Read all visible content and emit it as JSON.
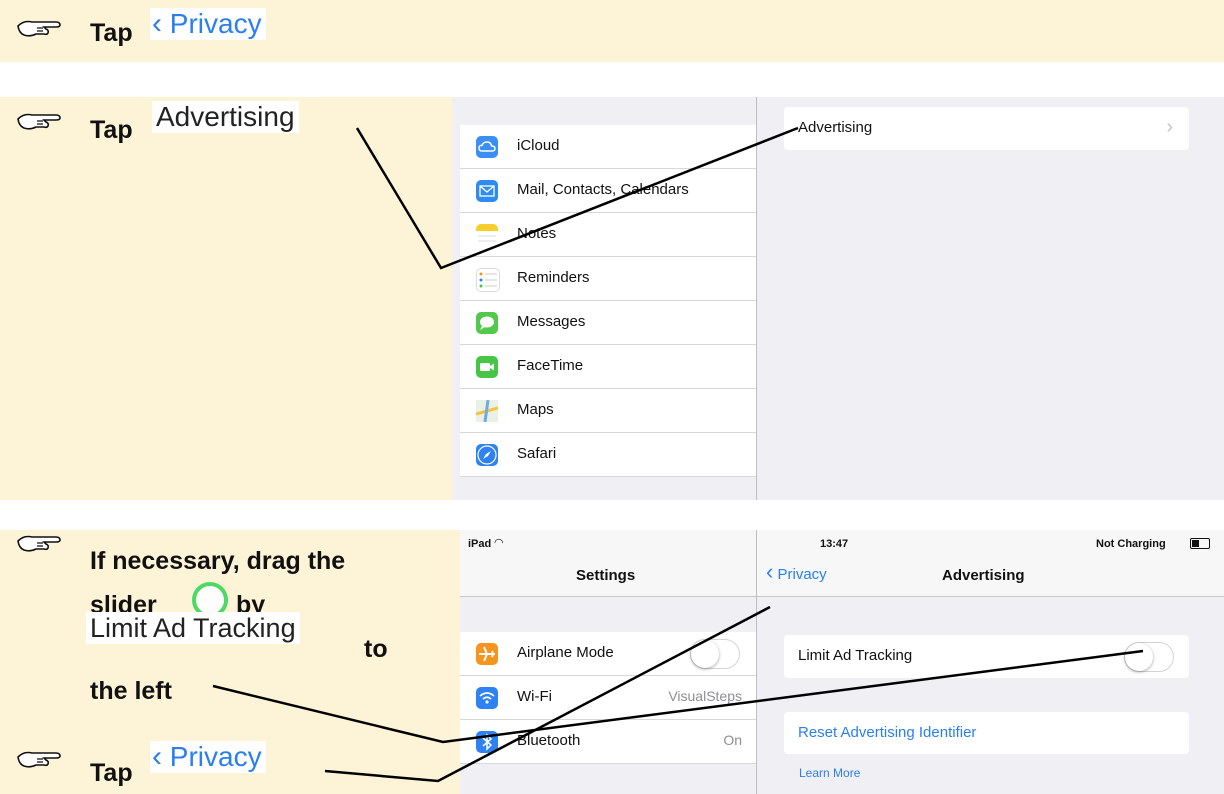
{
  "step1": {
    "tap": "Tap",
    "target": "Privacy"
  },
  "step2": {
    "tap": "Tap",
    "target": "Advertising"
  },
  "step3": {
    "line1": "If necessary, drag the",
    "line2a": "slider",
    "line2b": "by",
    "target": "Limit Ad Tracking",
    "line3a": "to",
    "line4": "the left"
  },
  "step4": {
    "tap": "Tap",
    "target": "Privacy"
  },
  "screen1": {
    "list": [
      {
        "label": "iCloud",
        "icon": "cloud-icon",
        "color": "#3b8ef5"
      },
      {
        "label": "Mail, Contacts, Calendars",
        "icon": "mail-icon",
        "color": "#2f8bf0"
      },
      {
        "label": "Notes",
        "icon": "notes-icon",
        "color": "#f7cf2c"
      },
      {
        "label": "Reminders",
        "icon": "reminders-icon",
        "color": "#ffffff"
      },
      {
        "label": "Messages",
        "icon": "messages-icon",
        "color": "#52c84d"
      },
      {
        "label": "FaceTime",
        "icon": "facetime-icon",
        "color": "#47c547"
      },
      {
        "label": "Maps",
        "icon": "maps-icon",
        "color": "#6fa9e8"
      },
      {
        "label": "Safari",
        "icon": "safari-icon",
        "color": "#2f82f1"
      }
    ],
    "detail": {
      "advertising": "Advertising",
      "chevron": "›"
    }
  },
  "screen2": {
    "status": {
      "device": "iPad",
      "time": "13:47",
      "battery": "Not Charging"
    },
    "master_title": "Settings",
    "back": "Privacy",
    "detail_title": "Advertising",
    "list": [
      {
        "label": "Airplane Mode",
        "value": "",
        "icon": "airplane-icon",
        "color": "#f7941d"
      },
      {
        "label": "Wi-Fi",
        "value": "VisualSteps",
        "icon": "wifi-icon",
        "color": "#2f82f1"
      },
      {
        "label": "Bluetooth",
        "value": "On",
        "icon": "bluetooth-icon",
        "color": "#2f82f1"
      }
    ],
    "limit_ad": "Limit Ad Tracking",
    "reset": "Reset Advertising Identifier",
    "learn_more": "Learn More"
  },
  "colors": {
    "band": "#fdf3d7",
    "ios_blue": "#2a7ff0",
    "ios_bg": "#efeff4"
  }
}
